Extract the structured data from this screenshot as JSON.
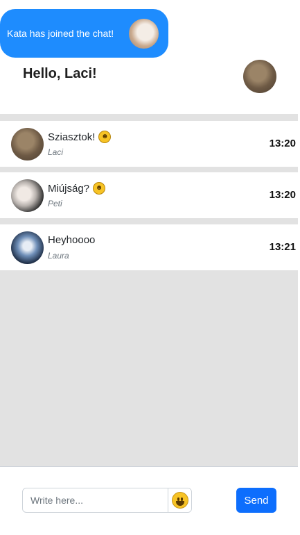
{
  "notification": {
    "text": "Kata has joined the chat!",
    "bubble_color": "#1e8cfe"
  },
  "header": {
    "greeting": "Hello, Laci!"
  },
  "messages": [
    {
      "text": "Sziasztok!",
      "emoji": "grinning-face-emoji",
      "author": "Laci",
      "time": "13:20"
    },
    {
      "text": "Miújság?",
      "emoji": "rolling-on-floor-laughing-emoji",
      "author": "Peti",
      "time": "13:20"
    },
    {
      "text": "Heyhoooo",
      "emoji": "",
      "author": "Laura",
      "time": "13:21"
    }
  ],
  "composer": {
    "placeholder": "Write here...",
    "emoji_icon": "smiley-emoji-icon",
    "send_label": "Send",
    "send_color": "#0d6efd"
  }
}
